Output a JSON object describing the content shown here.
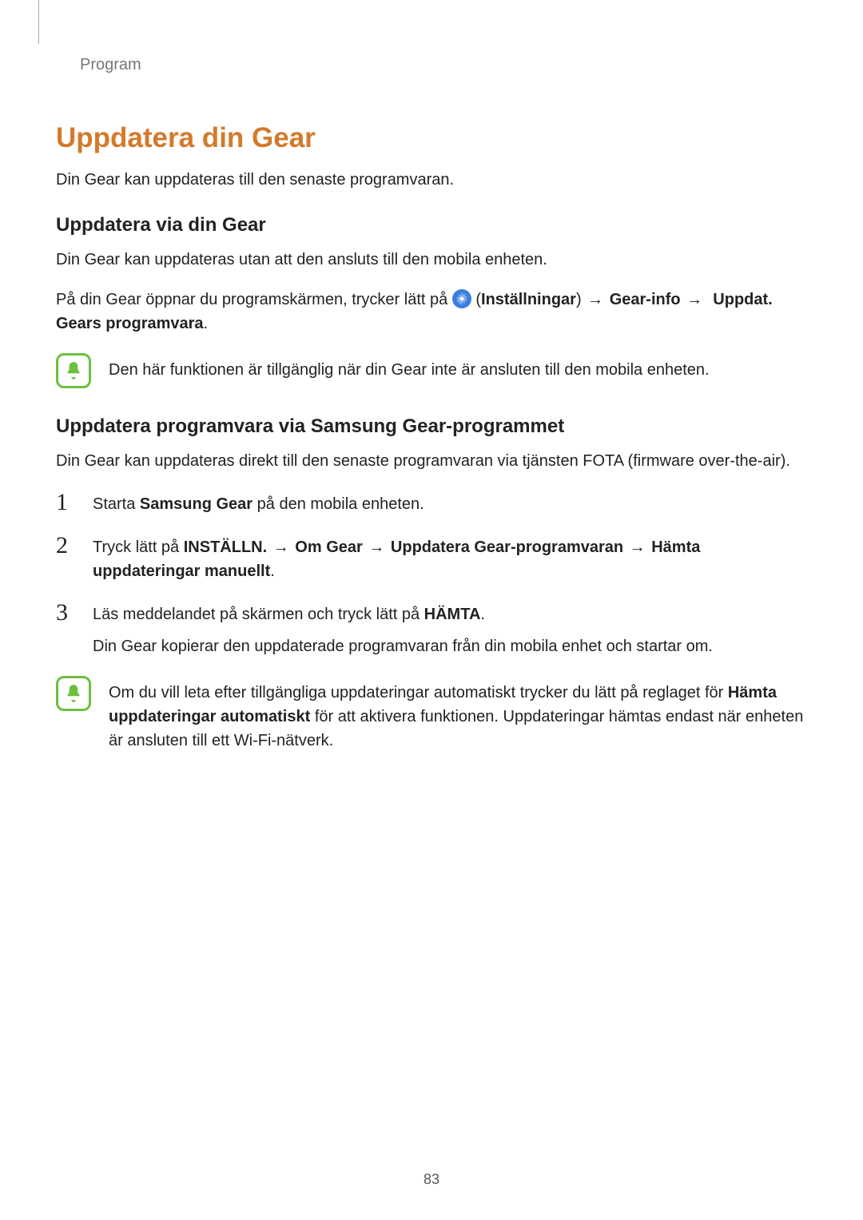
{
  "header": {
    "section": "Program"
  },
  "title": "Uppdatera din Gear",
  "intro": "Din Gear kan uppdateras till den senaste programvaran.",
  "sub1": {
    "heading": "Uppdatera via din Gear",
    "p1": "Din Gear kan uppdateras utan att den ansluts till den mobila enheten.",
    "p2_pre": "På din Gear öppnar du programskärmen, trycker lätt på ",
    "p2_paren_open": " (",
    "p2_settings": "Inställningar",
    "p2_paren_close": ") ",
    "arrow": "→",
    "p2_gearinfo": " Gear-info ",
    "p2_update": "Uppdat. Gears programvara",
    "period": ".",
    "note": "Den här funktionen är tillgänglig när din Gear inte är ansluten till den mobila enheten."
  },
  "sub2": {
    "heading": "Uppdatera programvara via Samsung Gear-programmet",
    "p1": "Din Gear kan uppdateras direkt till den senaste programvaran via tjänsten FOTA (firmware over-the-air).",
    "steps": {
      "n1": "1",
      "s1_pre": "Starta ",
      "s1_bold": "Samsung Gear",
      "s1_post": " på den mobila enheten.",
      "n2": "2",
      "s2_pre": "Tryck lätt på ",
      "s2_b1": "INSTÄLLN.",
      "s2_b2": "Om Gear",
      "s2_b3": "Uppdatera Gear-programvaran",
      "s2_b4": "Hämta uppdateringar manuellt",
      "n3": "3",
      "s3_pre": "Läs meddelandet på skärmen och tryck lätt på ",
      "s3_b1": "HÄMTA",
      "s3_sub": "Din Gear kopierar den uppdaterade programvaran från din mobila enhet och startar om."
    },
    "note_pre": "Om du vill leta efter tillgängliga uppdateringar automatiskt trycker du lätt på reglaget för ",
    "note_bold": "Hämta uppdateringar automatiskt",
    "note_post": " för att aktivera funktionen. Uppdateringar hämtas endast när enheten är ansluten till ett Wi-Fi-nätverk."
  },
  "page_number": "83"
}
